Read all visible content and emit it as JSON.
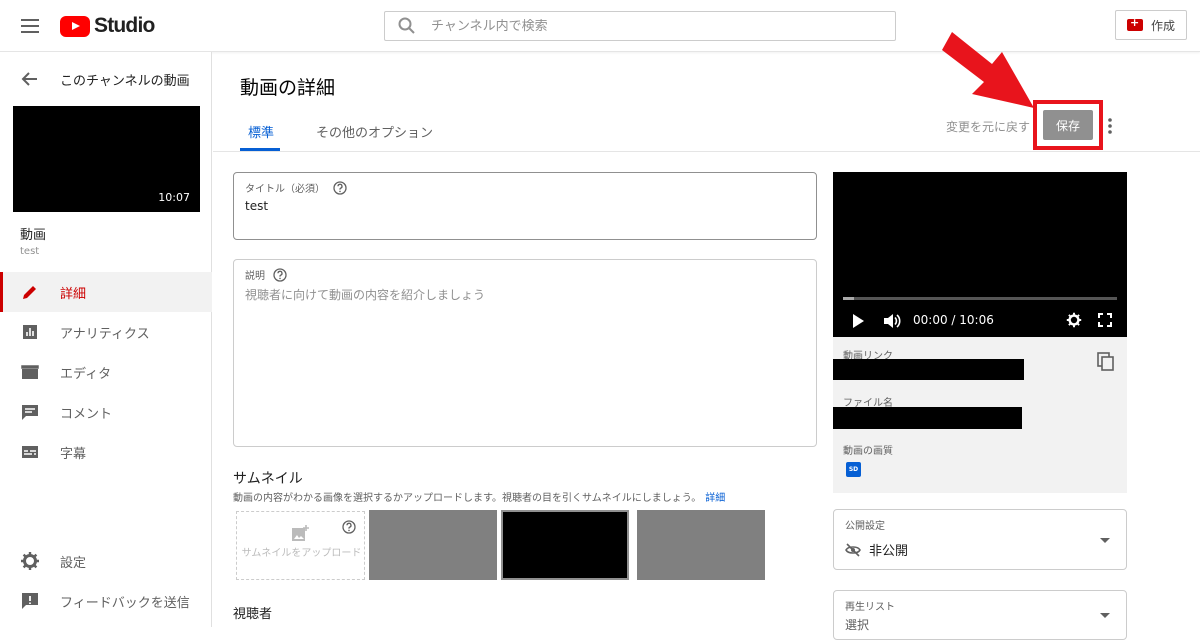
{
  "header": {
    "logo_text": "Studio",
    "search_placeholder": "チャンネル内で検索",
    "create_label": "作成"
  },
  "sidebar": {
    "back_label": "このチャンネルの動画",
    "thumb_duration": "10:07",
    "video_label": "動画",
    "video_name": "test",
    "items": [
      {
        "label": "詳細",
        "icon": "pencil-icon",
        "active": true
      },
      {
        "label": "アナリティクス",
        "icon": "analytics-icon",
        "active": false
      },
      {
        "label": "エディタ",
        "icon": "clapperboard-icon",
        "active": false
      },
      {
        "label": "コメント",
        "icon": "comment-icon",
        "active": false
      },
      {
        "label": "字幕",
        "icon": "subtitles-icon",
        "active": false
      }
    ],
    "settings_label": "設定",
    "feedback_label": "フィードバックを送信"
  },
  "main": {
    "title": "動画の詳細",
    "tabs": [
      {
        "label": "標準"
      },
      {
        "label": "その他のオプション"
      }
    ],
    "undo_label": "変更を元に戻す",
    "save_label": "保存",
    "title_field": {
      "label": "タイトル（必須）",
      "value": "test"
    },
    "description_field": {
      "label": "説明",
      "placeholder": "視聴者に向けて動画の内容を紹介しましょう"
    },
    "thumbnail": {
      "heading": "サムネイル",
      "description": "動画の内容がわかる画像を選択するかアップロードします。視聴者の目を引くサムネイルにしましょう。",
      "link": "詳細",
      "upload_label": "サムネイルをアップロード"
    },
    "audience_heading": "視聴者"
  },
  "video_panel": {
    "current_time": "00:00 / 10:06",
    "progress": 0.04,
    "link_label": "動画リンク",
    "filename_label": "ファイル名",
    "quality_label": "動画の画質",
    "quality_badge": "SD"
  },
  "visibility": {
    "label": "公開設定",
    "value": "非公開"
  },
  "playlist": {
    "label": "再生リスト",
    "value": "選択"
  },
  "colors": {
    "accent": "#065fd4",
    "brand_red": "#ff0000",
    "highlight": "#e8141c"
  }
}
